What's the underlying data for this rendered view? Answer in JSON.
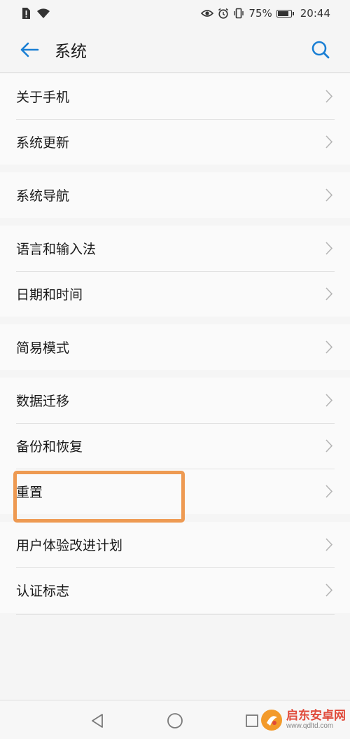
{
  "status_bar": {
    "battery_percent": "75%",
    "time": "20:44"
  },
  "app_bar": {
    "title": "系统"
  },
  "groups": [
    {
      "items": [
        {
          "label": "关于手机"
        },
        {
          "label": "系统更新"
        }
      ]
    },
    {
      "items": [
        {
          "label": "系统导航"
        }
      ]
    },
    {
      "items": [
        {
          "label": "语言和输入法"
        },
        {
          "label": "日期和时间"
        }
      ]
    },
    {
      "items": [
        {
          "label": "简易模式"
        }
      ]
    },
    {
      "items": [
        {
          "label": "数据迁移"
        },
        {
          "label": "备份和恢复"
        },
        {
          "label": "重置"
        }
      ]
    },
    {
      "items": [
        {
          "label": "用户体验改进计划"
        },
        {
          "label": "认证标志"
        }
      ]
    }
  ],
  "watermark": {
    "name": "启东安卓网",
    "url": "www.qdltd.com"
  },
  "colors": {
    "accent": "#1a7fd4",
    "highlight_border": "#ee9a52",
    "watermark_red": "#e04a3a"
  }
}
